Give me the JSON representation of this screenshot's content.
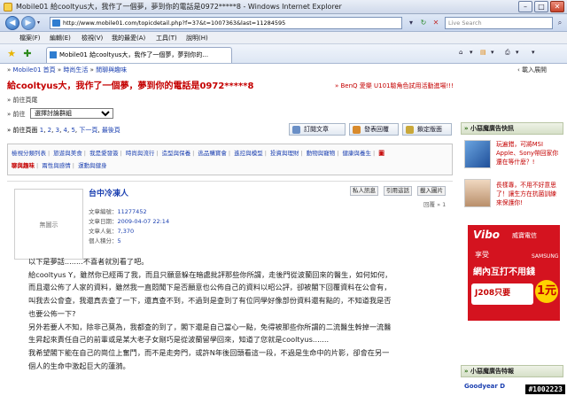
{
  "window": {
    "title": "Mobile01 給cooltyus大，我作了一個夢，夢到你的電話是0972*****8 - Windows Internet Explorer",
    "minimize": "–",
    "maximize": "□",
    "close": "✕"
  },
  "address": {
    "url": "http://www.mobile01.com/topicdetail.php?f=37&t=1007363&last=11284595",
    "search_placeholder": "Live Search",
    "refresh": "↻",
    "stop": "✕",
    "go": "⟶"
  },
  "menu": [
    "檔案(F)",
    "編輯(E)",
    "檢視(V)",
    "我的最愛(A)",
    "工具(T)",
    "說明(H)"
  ],
  "tabs": {
    "active_label": "Mobile01 給cooltyus大，我作了一個夢，夢到你的...",
    "home": "⌂",
    "feeds": "▤",
    "print": "⎙",
    "page_menu": "▾"
  },
  "page": {
    "breadcrumb": [
      "Mobile01 首頁",
      "時尚生活",
      "閒聊與趣味"
    ],
    "breadcrumb_sep": "»",
    "expand_arrow": "‹ 載入展開",
    "topic_title": "給cooltyus大，我作了一個夢，夢到你的電話是0972*****8",
    "sponsored": "» BenQ 愛樂 U101驗角色試用活動進場!!!",
    "back_link": "» 前往頁尾",
    "goto_label": "» 前往",
    "goto_select": "選擇討論群組",
    "pager": {
      "prefix": "» 前往頁面",
      "pages": [
        "1",
        "2",
        "3",
        "4",
        "5"
      ],
      "next": "下一頁",
      "last": "最後頁"
    },
    "buttons": {
      "subscribe": "訂閱文章",
      "reply": "發表回覆",
      "lock": "鎖定版面"
    },
    "categories": [
      "檢視分類列表",
      "旅遊與美食",
      "我是愛發簽",
      "時尚與流行",
      "造型與保養",
      "逃品購寶會",
      "進控與模型",
      "投資與理財",
      "動物與寵物",
      "健康與養生",
      "圖",
      "聊與趣味",
      "兩性與感情",
      "運動與健身"
    ],
    "post": {
      "avatar_text": "無圖示",
      "author": "台中冷凍人",
      "meta": [
        {
          "label": "文章編號：",
          "value": "11277452"
        },
        {
          "label": "文章日期：",
          "value": "2009-04-07 22:14"
        },
        {
          "label": "文章人氣：",
          "value": "7,370"
        },
        {
          "label": "個人積分：",
          "value": "5"
        }
      ],
      "actions": [
        "私人訊息",
        "引用這話",
        "載入圖片"
      ],
      "floor": "回覆 » 1",
      "body": [
        "以下是夢話........不喜者就別看了吧。",
        "給cooltyus Y，雖然你已經兩了我，而且只願意躲在暗處批評那些你所謂，走後門從波蘭回來的醫生，如何如何，",
        "而且還公佈了人家的資料，雖然我一直悶聞下是否願意也公佈自己的資料以昭公評，卻被閣下回覆資料在公會有，",
        "叫我去公會查，我還真去查了一下，還真查不到，不過到是查到了有位同學好像部份資料還有點的，不知道我是否",
        "也要公佈一下?",
        "另外若要人不知，除非己莫為，我都查的到了，閣下還是自己當心一點，免得被那些你所謂的二流醫生幹掉一流醫",
        "生昇起來責任自己的前輩或是某大老子女剛巧是從波蘭留學回來，知道了您就是cooltyus.......",
        "我希望閣下能在自己的崗位上奮鬥，而不是走旁門，或許N年後回頭看這一段，不過是生命中的片影，卻會在另一",
        "個人的生命中激起巨大的蓮漪。"
      ]
    }
  },
  "sidebar": {
    "ad_header": "小惡魔廣告快訊",
    "ads": [
      {
        "text": "玩遍錯，可將MSI Apple、Sony帶回家你還在等什麼？!"
      },
      {
        "text": "長樣專，不用不好意思了！讓生方在抗菌訓練來保護你!"
      }
    ],
    "banner": {
      "brand": "Vibo",
      "tagline": "威寶電信",
      "l1": "享受",
      "l2": "網內互打不用錢",
      "plan": "J208只要",
      "price": "1元",
      "samsung": "SAMSUNG"
    },
    "bottom_header": "小惡魔廣告特報",
    "bottom_item": "Goodyear D"
  },
  "watermark": "#1002223"
}
